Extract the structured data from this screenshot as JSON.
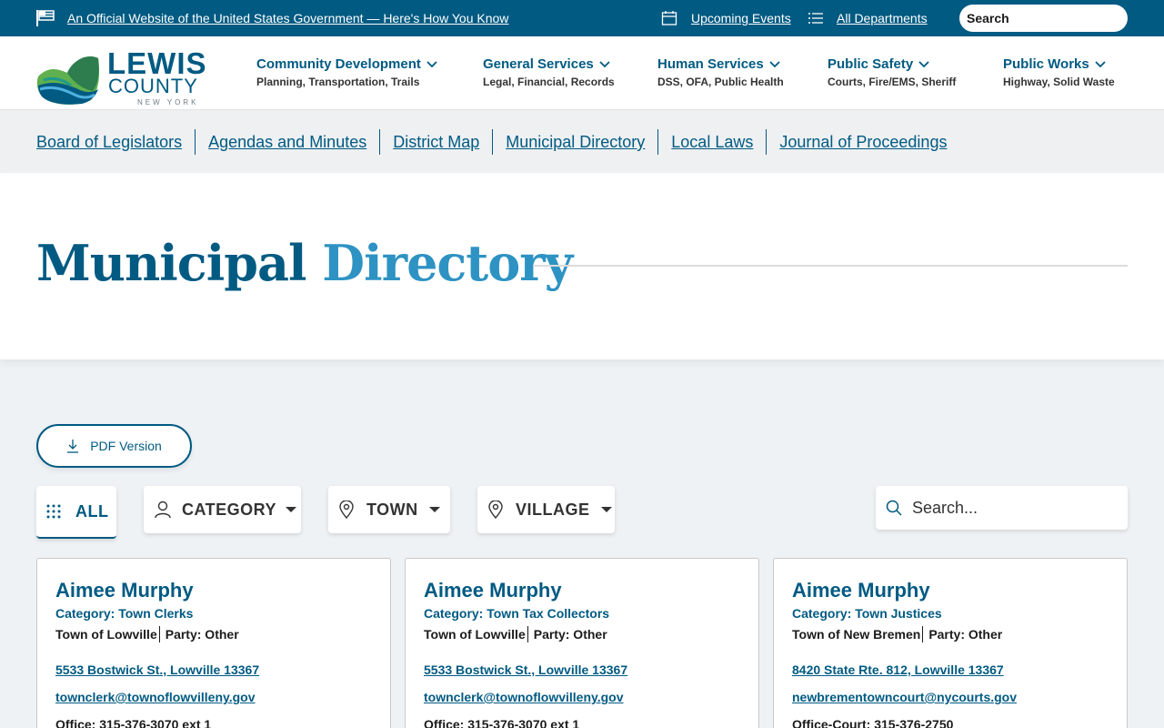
{
  "gov_bar": {
    "official_text": "An Official Website of the United States Government — Here's How You Know",
    "events_label": "Upcoming Events",
    "departments_label": "All Departments",
    "search_placeholder": "Search"
  },
  "logo": {
    "line1": "LEWIS",
    "line2": "COUNTY",
    "line3": "NEW YORK"
  },
  "main_nav": [
    {
      "title": "Community Development",
      "subtitle": "Planning, Transportation, Trails"
    },
    {
      "title": "General Services",
      "subtitle": "Legal, Financial, Records"
    },
    {
      "title": "Human Services",
      "subtitle": "DSS, OFA, Public Health"
    },
    {
      "title": "Public Safety",
      "subtitle": "Courts, Fire/EMS, Sheriff"
    },
    {
      "title": "Public Works",
      "subtitle": "Highway, Solid Waste"
    }
  ],
  "sub_nav": [
    "Board of Legislators",
    "Agendas and Minutes",
    "District Map",
    "Municipal Directory",
    "Local Laws",
    "Journal of Proceedings"
  ],
  "page_title": {
    "word1": "Municipal",
    "word2": "Directory"
  },
  "pdf_button": "PDF Version",
  "filters": {
    "all": "ALL",
    "category": "CATEGORY",
    "town": "TOWN",
    "village": "VILLAGE"
  },
  "search": {
    "placeholder": "Search..."
  },
  "cards": [
    {
      "name": "Aimee Murphy",
      "category": "Category: Town Clerks",
      "location": "Town of Lowville",
      "party": "Party: Other",
      "address": "5533 Bostwick St., Lowville 13367",
      "email": "townclerk@townoflowvilleny.gov",
      "phone": "Office: 315-376-3070 ext 1"
    },
    {
      "name": "Aimee Murphy",
      "category": "Category: Town Tax Collectors",
      "location": "Town of Lowville",
      "party": "Party: Other",
      "address": "5533 Bostwick St., Lowville 13367",
      "email": "townclerk@townoflowvilleny.gov",
      "phone": "Office: 315-376-3070 ext 1"
    },
    {
      "name": "Aimee Murphy",
      "category": "Category: Town Justices",
      "location": "Town of New Bremen",
      "party": "Party: Other",
      "address": "8420 State Rte. 812, Lowville 13367",
      "email": "newbrementowncourt@nycourts.gov",
      "phone": "Office-Court: 315-376-2750"
    }
  ],
  "colors": {
    "brand_blue": "#005a82",
    "accent_blue": "#2e93c3",
    "logo_green": "#5fb04e"
  }
}
